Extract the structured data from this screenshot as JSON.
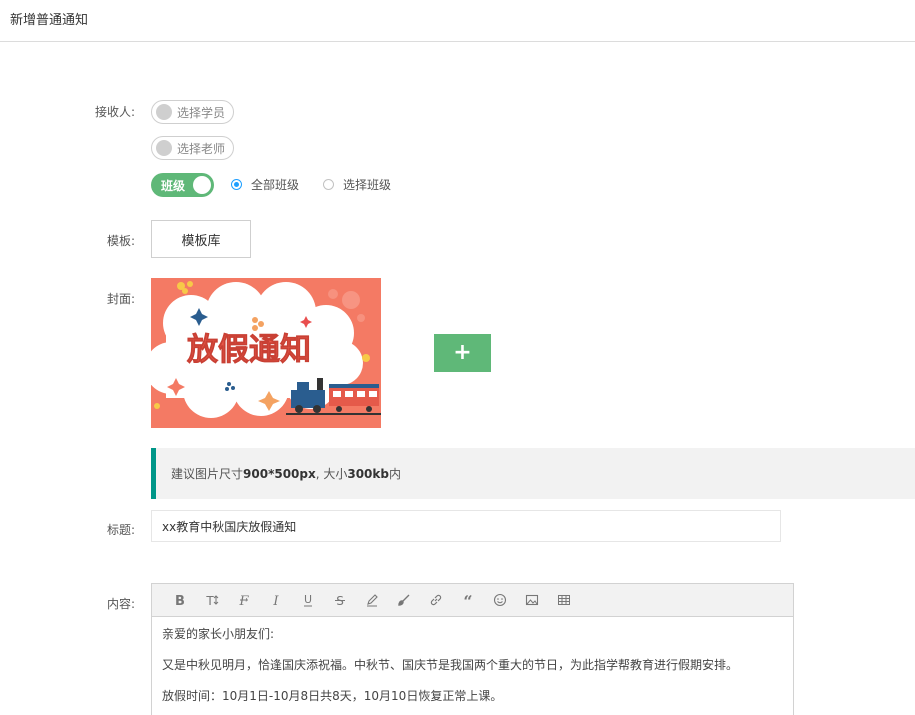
{
  "header": {
    "title": "新增普通通知"
  },
  "form": {
    "receiver_label": "接收人:",
    "select_students": "选择学员",
    "select_teachers": "选择老师",
    "class_toggle": "班级",
    "radio_all": "全部班级",
    "radio_select": "选择班级",
    "radio_selected": "all",
    "template_label": "模板:",
    "template_button": "模板库",
    "cover_label": "封面:",
    "cover_text": "放假通知",
    "add_button": "+",
    "tip_prefix": "建议图片尺寸",
    "tip_size": "900*500px",
    "tip_mid": ", 大小",
    "tip_weight": "300kb",
    "tip_suffix": "内",
    "title_label": "标题:",
    "title_value": "xx教育中秋国庆放假通知",
    "content_label": "内容:"
  },
  "editor": {
    "tools": [
      "bold-icon",
      "text-size-icon",
      "clear-format-icon",
      "italic-icon",
      "underline-icon",
      "strikethrough-icon",
      "highlighter-icon",
      "brush-icon",
      "link-icon",
      "quote-icon",
      "emoji-icon",
      "image-icon",
      "table-icon"
    ],
    "lines": [
      "亲爱的家长小朋友们:",
      "又是中秋见明月，恰逢国庆添祝福。中秋节、国庆节是我国两个重大的节日，为此指学帮教育进行假期安排。",
      "放假时间：10月1日-10月8日共8天，10月10日恢复正常上课。"
    ]
  },
  "colors": {
    "accent_green": "#5fb878",
    "tip_border": "#009688",
    "radio_blue": "#1e9fff",
    "cover_bg": "#f47a64"
  }
}
